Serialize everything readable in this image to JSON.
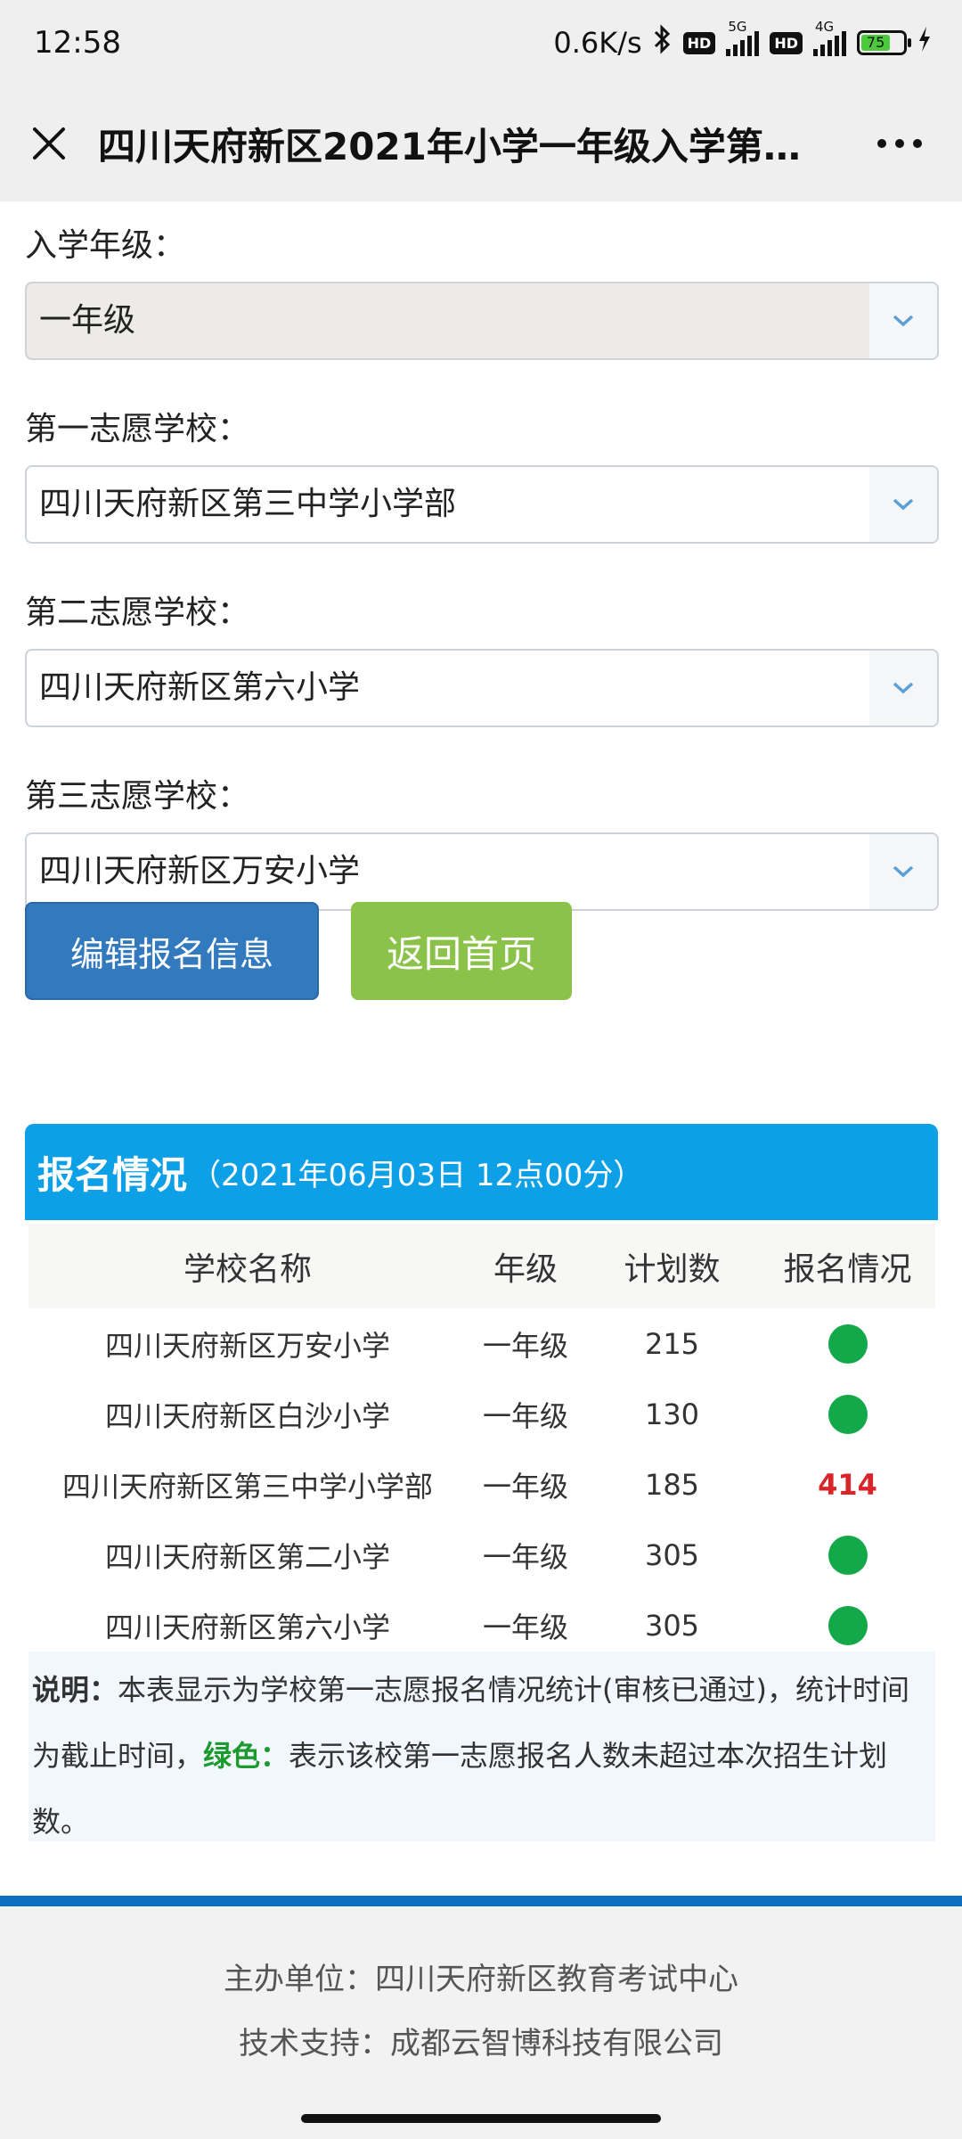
{
  "status_bar": {
    "time": "12:58",
    "net_speed": "0.6K/s",
    "hd1": "HD",
    "sig1_label": "5G",
    "hd2": "HD",
    "sig2_label": "4G",
    "battery": "75"
  },
  "header": {
    "title": "四川天府新区2021年小学一年级入学第…"
  },
  "form": {
    "fields": [
      {
        "label": "入学年级：",
        "value": "一年级"
      },
      {
        "label": "第一志愿学校：",
        "value": "四川天府新区第三中学小学部"
      },
      {
        "label": "第二志愿学校：",
        "value": "四川天府新区第六小学"
      },
      {
        "label": "第三志愿学校：",
        "value": "四川天府新区万安小学"
      }
    ],
    "edit_button": "编辑报名信息",
    "home_button": "返回首页"
  },
  "stats": {
    "title": "报名情况",
    "time": "（2021年06月03日 12点00分）",
    "columns": [
      "学校名称",
      "年级",
      "计划数",
      "报名情况"
    ],
    "rows": [
      {
        "school": "四川天府新区万安小学",
        "grade": "一年级",
        "plan": "215",
        "status": "green"
      },
      {
        "school": "四川天府新区白沙小学",
        "grade": "一年级",
        "plan": "130",
        "status": "green"
      },
      {
        "school": "四川天府新区第三中学小学部",
        "grade": "一年级",
        "plan": "185",
        "status": "414"
      },
      {
        "school": "四川天府新区第二小学",
        "grade": "一年级",
        "plan": "305",
        "status": "green"
      },
      {
        "school": "四川天府新区第六小学",
        "grade": "一年级",
        "plan": "305",
        "status": "green"
      }
    ]
  },
  "note": {
    "label": "说明：",
    "text1": "本表显示为学校第一志愿报名情况统计(审核已通过)，统计时间为截止时间，",
    "green_label": "绿色：",
    "text2": "表示该校第一志愿报名人数未超过本次招生计划数。"
  },
  "footer": {
    "organizer": "主办单位：四川天府新区教育考试中心",
    "support": "技术支持：成都云智博科技有限公司"
  },
  "colors": {
    "panel_header": "#0ea0e6",
    "edit_button": "#3279bd",
    "home_button": "#8bc34a",
    "ok_dot": "#13a84a",
    "over_text": "#d9252a"
  }
}
